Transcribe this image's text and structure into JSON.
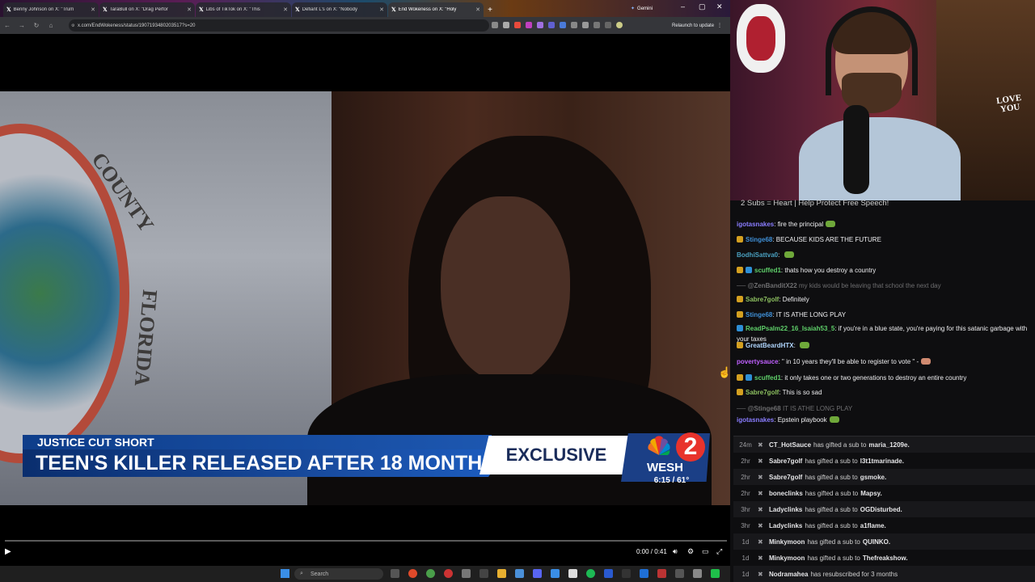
{
  "browser": {
    "tabs": [
      {
        "title": "Benny Johnson on X: \"Trum"
      },
      {
        "title": "TaraBull on X: \"Drag Perfor"
      },
      {
        "title": "Libs of TikTok on X: \"This"
      },
      {
        "title": "Defiant L's on X: \"Nobody"
      },
      {
        "title": "End Wokeness on X: \"Holy"
      }
    ],
    "gemini_label": "Gemini",
    "url": "x.com/EndWokeness/status/1907193480203517?s=20",
    "relaunch_label": "Relaunch to update"
  },
  "video": {
    "lower_third_top": "JUSTICE CUT SHORT",
    "lower_third_main": "TEEN'S KILLER RELEASED AFTER 18 MONTHS",
    "exclusive": "EXCLUSIVE",
    "station_number": "2",
    "station_name": "WESH",
    "time_temp": "6:15 / 61°",
    "timecode": "0:00 / 0:41",
    "progress_fraction": 0.0
  },
  "taskbar": {
    "search_placeholder": "Search"
  },
  "webcam": {
    "sign_text_1": "LOVE",
    "sign_text_2": "YOU"
  },
  "chat": {
    "banner": "2 Subs = Heart | Help Protect Free Speech!",
    "messages": [
      {
        "user": "igotasnakes",
        "user_color": "#8a7dff",
        "text": "fire the principal",
        "emote": "#6fa83a",
        "badges": []
      },
      {
        "user": "Stinge68",
        "user_color": "#3f8fd6",
        "text": "BECAUSE KIDS ARE THE FUTURE",
        "emote": "",
        "badges": [
          "#d4a020"
        ]
      },
      {
        "user": "BodhiSattva0",
        "user_color": "#4aa0c0",
        "text": "",
        "emote": "#6fa83a",
        "badges": []
      },
      {
        "user": "scuffed1",
        "user_color": "#5fd06a",
        "text": "thats how you destroy a country",
        "emote": "",
        "badges": [
          "#d4a020",
          "#2e8fd6"
        ]
      },
      {
        "user": "@ZenBanditX22",
        "user_color": "#6e6e70",
        "text": "my kids would be leaving that school the next day",
        "emote": "",
        "badges": [],
        "deleted": true
      },
      {
        "user": "Sabre7golf",
        "user_color": "#8dc060",
        "text": "Definitely",
        "emote": "",
        "badges": [
          "#d4a020"
        ]
      },
      {
        "user": "Stinge68",
        "user_color": "#3f8fd6",
        "text": "IT IS ATHE LONG PLAY",
        "emote": "",
        "badges": [
          "#d4a020"
        ]
      },
      {
        "user": "ReadPsalm22_16_Isaiah53_5",
        "user_color": "#5fd06a",
        "text": "if you're in a blue state, you're paying for this satanic garbage with your taxes",
        "emote": "",
        "badges": [
          "#2e8fd6"
        ]
      },
      {
        "user": "GreatBeardHTX",
        "user_color": "#b0d6ff",
        "text": "",
        "emote": "#6fa83a",
        "badges": [
          "#d4a020"
        ]
      },
      {
        "user": "povertysauce",
        "user_color": "#c060ff",
        "text": "\" in 10 years they'll be able to register to vote \" -",
        "emote": "#d08a70",
        "badges": []
      },
      {
        "user": "scuffed1",
        "user_color": "#5fd06a",
        "text": "it only takes one or two generations to destroy an entire country",
        "emote": "",
        "badges": [
          "#d4a020",
          "#2e8fd6"
        ]
      },
      {
        "user": "Sabre7golf",
        "user_color": "#8dc060",
        "text": "This is so sad",
        "emote": "",
        "badges": [
          "#d4a020"
        ]
      },
      {
        "user": "@Stinge68",
        "user_color": "#6e6e70",
        "text": "IT IS ATHE LONG PLAY",
        "emote": "",
        "badges": [],
        "deleted": true
      },
      {
        "user": "igotasnakes",
        "user_color": "#8a7dff",
        "text": "Epstein playbook",
        "emote": "#6fa83a",
        "badges": []
      }
    ],
    "events": [
      {
        "time": "24m",
        "name": "CT_HotSauce",
        "action": "has gifted a sub to",
        "target": "maria_1209e."
      },
      {
        "time": "2hr",
        "name": "Sabre7golf",
        "action": "has gifted a sub to",
        "target": "l3t1tmarinade."
      },
      {
        "time": "2hr",
        "name": "Sabre7golf",
        "action": "has gifted a sub to",
        "target": "gsmoke."
      },
      {
        "time": "2hr",
        "name": "boneclinks",
        "action": "has gifted a sub to",
        "target": "Mapsy."
      },
      {
        "time": "3hr",
        "name": "Ladyclinks",
        "action": "has gifted a sub to",
        "target": "OGDisturbed."
      },
      {
        "time": "3hr",
        "name": "Ladyclinks",
        "action": "has gifted a sub to",
        "target": "a1flame."
      },
      {
        "time": "1d",
        "name": "Minkymoon",
        "action": "has gifted a sub to",
        "target": "QUINKO."
      },
      {
        "time": "1d",
        "name": "Minkymoon",
        "action": "has gifted a sub to",
        "target": "Thefreakshow."
      },
      {
        "time": "1d",
        "name": "Nodramahea",
        "action": "has resubscribed for 3 months",
        "target": ""
      }
    ]
  }
}
